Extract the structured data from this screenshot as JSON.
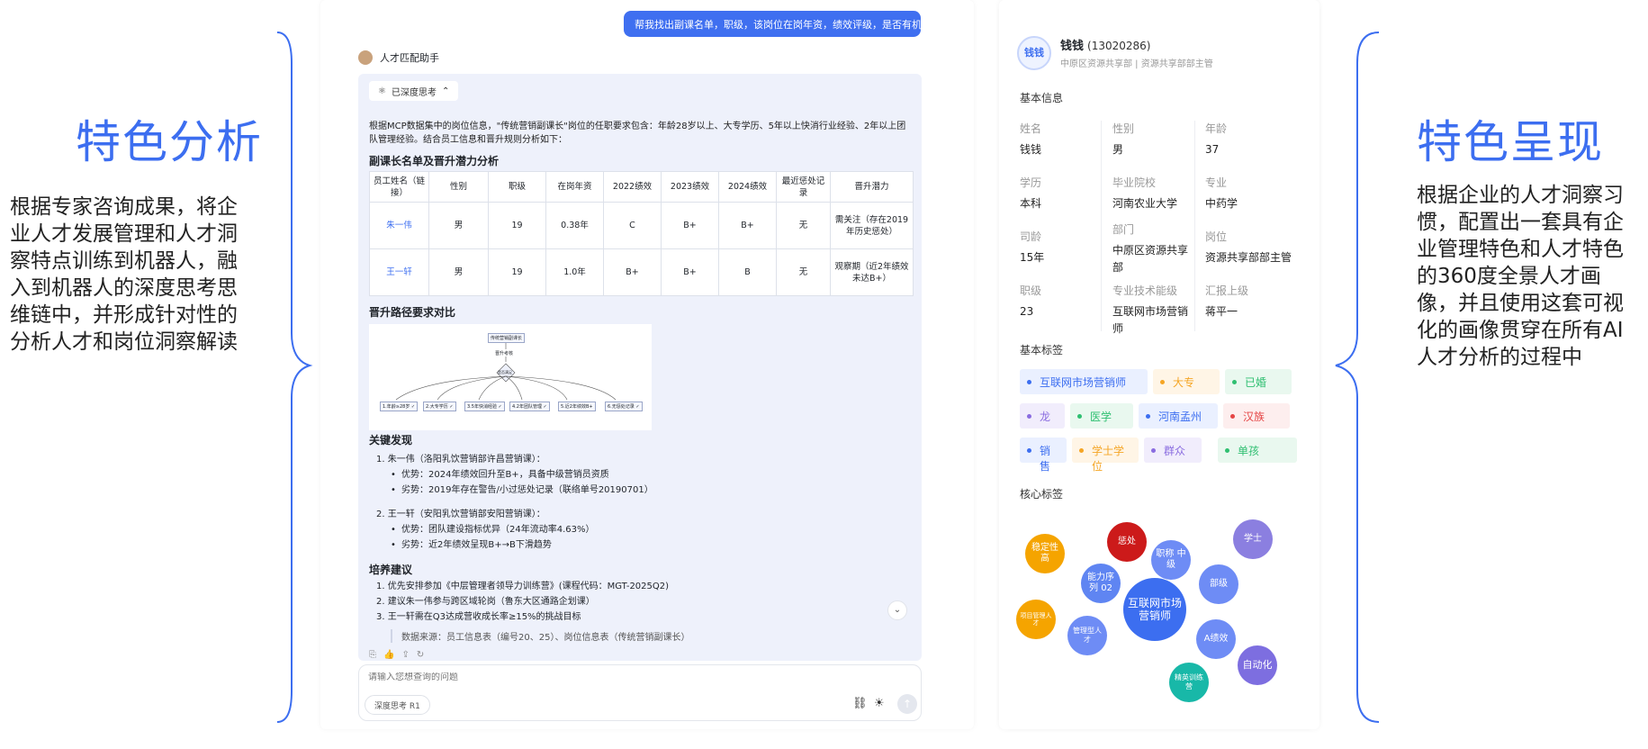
{
  "left_panel": {
    "title": "特色分析",
    "description": "根据专家咨询成果，将企业人才发展管理和人才洞察特点训练到机器人，融入到机器人的深度思考思维链中，并形成针对性的分析人才和岗位洞察解读"
  },
  "right_panel": {
    "title": "特色呈现",
    "description": "根据企业的人才洞察习惯，配置出一套具有企业管理特色和人才特色的360度全景人才画像，并且使用这套可视化的画像贯穿在所有AI人才分析的过程中"
  },
  "chat": {
    "user_message": "帮我找出副课名单，职级，该岗位在岗年资，绩效评级，是否有机会晋升课长",
    "bot_name": "人才匹配助手",
    "think_label": "已深度思考",
    "intro": "根据MCP数据集中的岗位信息，\"传统营销副课长\"岗位的任职要求包含：年龄28岁以上、大专学历、5年以上快消行业经验、2年以上团队管理经验。结合员工信息和晋升规则分析如下：",
    "table_title": "副课长名单及晋升潜力分析",
    "table": {
      "headers": [
        "员工姓名（链接）",
        "性别",
        "职级",
        "在岗年资",
        "2022绩效",
        "2023绩效",
        "2024绩效",
        "最近惩处记录",
        "晋升潜力"
      ],
      "rows": [
        [
          "朱一伟",
          "男",
          "19",
          "0.38年",
          "C",
          "B+",
          "B+",
          "无",
          "需关注（存在2019年历史惩处）"
        ],
        [
          "王一轩",
          "男",
          "19",
          "1.0年",
          "B+",
          "B+",
          "B",
          "无",
          "观察期（近2年绩效未达B+）"
        ]
      ]
    },
    "path_title": "晋升路径要求对比",
    "flow": {
      "top": "传统营销副课长",
      "mid": "晋升考核",
      "diamond": "是否满足",
      "leaves": [
        "1.年龄≥28岁 ✓",
        "2.大专学历 ✓",
        "3.5年快消经验 ✓",
        "4.2年团队管理 ✓",
        "5.近2年绩效B+",
        "6.无惩处记录 ✓"
      ]
    },
    "findings_title": "关键发现",
    "findings": [
      {
        "level": 1,
        "text": "1. 朱一伟（洛阳乳饮营销部许昌营销课）："
      },
      {
        "level": 2,
        "text": "优势：2024年绩效回升至B+，具备中级营销员资质"
      },
      {
        "level": 2,
        "text": "劣势：2019年存在警告/小过惩处记录（联络单号20190701）"
      },
      {
        "level": 1,
        "text": "2. 王一轩（安阳乳饮营销部安阳营销课）："
      },
      {
        "level": 2,
        "text": "优势：团队建设指标优异（24年流动率4.63%）"
      },
      {
        "level": 2,
        "text": "劣势：近2年绩效呈现B+→B下滑趋势"
      }
    ],
    "advice_title": "培养建议",
    "advice": [
      "1. 优先安排参加《中层管理者领导力训练营》(课程代码：MGT-2025Q2)",
      "2. 建议朱一伟参与跨区域轮岗（鲁东大区通路企划课）",
      "3. 王一轩需在Q3达成营收成长率≥15%的挑战目标"
    ],
    "source": "数据来源：员工信息表（编号20、25）、岗位信息表（传统营销副课长）",
    "input_placeholder": "请输入您想查询的问题",
    "deep_think_label": "深度思考 R1"
  },
  "profile": {
    "avatar_text": "钱钱",
    "name": "钱钱",
    "employee_id": "(13020286)",
    "subtitle": "中原区资源共享部  |  资源共享部部主管",
    "basic_info_title": "基本信息",
    "fields": [
      {
        "label": "姓名",
        "value": "钱钱"
      },
      {
        "label": "性别",
        "value": "男"
      },
      {
        "label": "年龄",
        "value": "37"
      },
      {
        "label": "学历",
        "value": "本科"
      },
      {
        "label": "毕业院校",
        "value": "河南农业大学"
      },
      {
        "label": "专业",
        "value": "中药学"
      },
      {
        "label": "司龄",
        "value": "15年"
      },
      {
        "label": "部门",
        "value": "中原区资源共享部"
      },
      {
        "label": "岗位",
        "value": "资源共享部部主管"
      },
      {
        "label": "职级",
        "value": "23"
      },
      {
        "label": "专业技术能级",
        "value": "互联网市场营销师"
      },
      {
        "label": "汇报上级",
        "value": "蒋平一"
      }
    ],
    "tags_title": "基本标签",
    "tags": [
      {
        "text": "互联网市场营销师",
        "color": "#3c6ef0",
        "bg": "#eaf0ff"
      },
      {
        "text": "大专",
        "color": "#f5a524",
        "bg": "#fff5e6"
      },
      {
        "text": "已婚",
        "color": "#2fbf71",
        "bg": "#e9f8ef"
      },
      {
        "text": "龙",
        "color": "#8a6ce0",
        "bg": "#f1edfc"
      },
      {
        "text": "医学",
        "color": "#2fbf71",
        "bg": "#e9f8ef"
      },
      {
        "text": "河南孟州",
        "color": "#3c6ef0",
        "bg": "#eaf0ff"
      },
      {
        "text": "汉族",
        "color": "#e54545",
        "bg": "#fdeeee"
      },
      {
        "text": "销售",
        "color": "#3c6ef0",
        "bg": "#eaf0ff"
      },
      {
        "text": "学士学位",
        "color": "#f5a524",
        "bg": "#fff5e6"
      },
      {
        "text": "群众",
        "color": "#8a6ce0",
        "bg": "#f1edfc"
      },
      {
        "text": "单孩",
        "color": "#2fbf71",
        "bg": "#e9f8ef"
      }
    ],
    "core_tags_title": "核心标签",
    "core_tags": [
      {
        "text": "稳定性高",
        "color": "#f5a400"
      },
      {
        "text": "惩处",
        "color": "#cc1a1a"
      },
      {
        "text": "职称 中级",
        "color": "#6e8cf5"
      },
      {
        "text": "学士",
        "color": "#8b7fe0"
      },
      {
        "text": "能力序列 02",
        "color": "#5f85f2"
      },
      {
        "text": "部级",
        "color": "#6e8cf5"
      },
      {
        "text": "项目管理人才",
        "color": "#f5a400"
      },
      {
        "text": "互联网市场营销师",
        "color": "#3c6ef0"
      },
      {
        "text": "管理型人才",
        "color": "#6e8cf5"
      },
      {
        "text": "A绩效",
        "color": "#6e8cf5"
      },
      {
        "text": "自动化",
        "color": "#7d6ee0"
      },
      {
        "text": "精英训练营",
        "color": "#18b8a8"
      }
    ]
  }
}
